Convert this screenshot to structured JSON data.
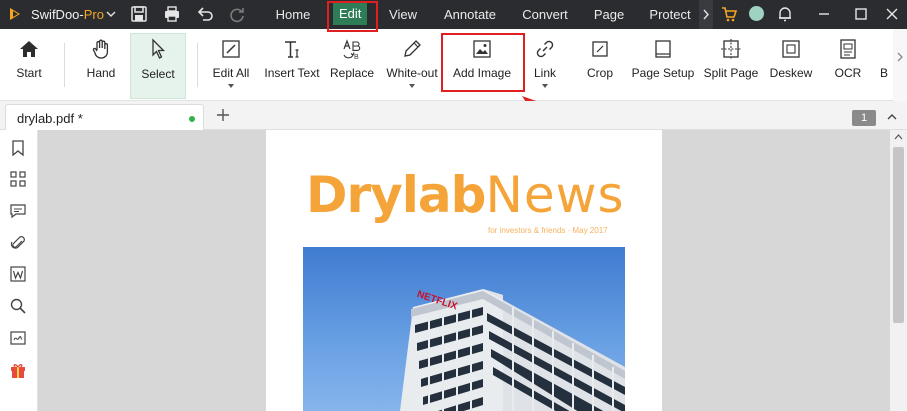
{
  "titlebar": {
    "app_name": "SwifDoo-",
    "app_name_suffix": "Pro",
    "menu": [
      {
        "label": "Home",
        "active": false
      },
      {
        "label": "Edit",
        "active": true
      },
      {
        "label": "View",
        "active": false
      },
      {
        "label": "Annotate",
        "active": false
      },
      {
        "label": "Convert",
        "active": false
      },
      {
        "label": "Page",
        "active": false
      },
      {
        "label": "Protect",
        "active": false
      }
    ],
    "accent_color": "#2e7d57"
  },
  "ribbon": {
    "tools": [
      {
        "label": "Start",
        "icon": "home-icon"
      },
      {
        "label": "Hand",
        "icon": "hand-icon"
      },
      {
        "label": "Select",
        "icon": "cursor-icon",
        "selected": true
      },
      {
        "label": "Edit All",
        "icon": "edit-all-icon",
        "dropdown": true
      },
      {
        "label": "Insert Text",
        "icon": "insert-text-icon"
      },
      {
        "label": "Replace",
        "icon": "replace-icon"
      },
      {
        "label": "White-out",
        "icon": "white-out-icon",
        "dropdown": true
      },
      {
        "label": "Add Image",
        "icon": "add-image-icon",
        "highlighted": true
      },
      {
        "label": "Link",
        "icon": "link-icon",
        "dropdown": true
      },
      {
        "label": "Crop",
        "icon": "crop-icon"
      },
      {
        "label": "Page Setup",
        "icon": "page-setup-icon"
      },
      {
        "label": "Split Page",
        "icon": "split-page-icon"
      },
      {
        "label": "Deskew",
        "icon": "deskew-icon"
      },
      {
        "label": "OCR",
        "icon": "ocr-icon"
      },
      {
        "label": "B",
        "icon": "more-icon"
      }
    ]
  },
  "tabs": {
    "document": "drylab.pdf *",
    "page_number": "1"
  },
  "sidebar": {
    "icons": [
      "bookmark-icon",
      "thumbnails-icon",
      "comments-icon",
      "attachment-icon",
      "word-icon",
      "search-icon",
      "signature-icon",
      "gift-icon"
    ]
  },
  "document": {
    "headline_bold": "Drylab",
    "headline_thin": "News",
    "tagline": "for investors & friends · May 2017",
    "photo_sign": "NETFLIX",
    "headline_color": "#f5a43a"
  }
}
